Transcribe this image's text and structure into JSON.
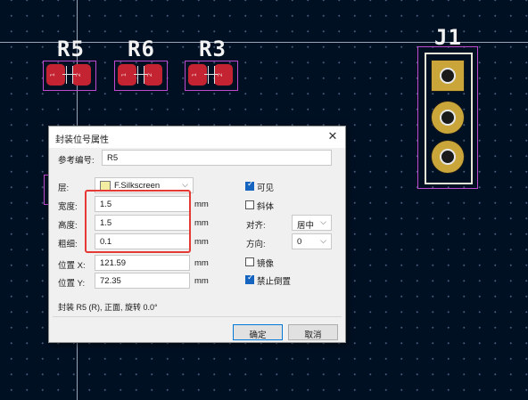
{
  "canvas": {
    "colors": {
      "background": "#001023",
      "pad": "#c42431",
      "courtyard": "#c24ad0",
      "silkscreen": "#f2f2f2",
      "tht_pad": "#c9a53a"
    },
    "references": {
      "r5": "R5",
      "r6": "R6",
      "r3": "R3",
      "j1": "J1"
    },
    "pad_numbers": {
      "one": "1",
      "two": "2"
    }
  },
  "dialog": {
    "title": "封装位号属性",
    "close_icon": "close-icon",
    "ref_label": "参考编号:",
    "ref_value": "R5",
    "layer_label": "层:",
    "layer_value": "F.Silkscreen",
    "width_label": "宽度:",
    "width_value": "1.5",
    "height_label": "高度:",
    "height_value": "1.5",
    "thickness_label": "粗细:",
    "thickness_value": "0.1",
    "posx_label": "位置 X:",
    "posx_value": "121.59",
    "posy_label": "位置 Y:",
    "posy_value": "72.35",
    "unit": "mm",
    "visible_label": "可见",
    "italic_label": "斜体",
    "align_label": "对齐:",
    "align_value": "居中",
    "orientation_label": "方向:",
    "orientation_value": "0",
    "mirror_label": "镜像",
    "keep_upright_label": "禁止倒置",
    "info_text": "封装 R5 (R), 正面, 旋转 0.0°",
    "ok_label": "确定",
    "cancel_label": "取消",
    "highlight_color": "#e53935"
  }
}
